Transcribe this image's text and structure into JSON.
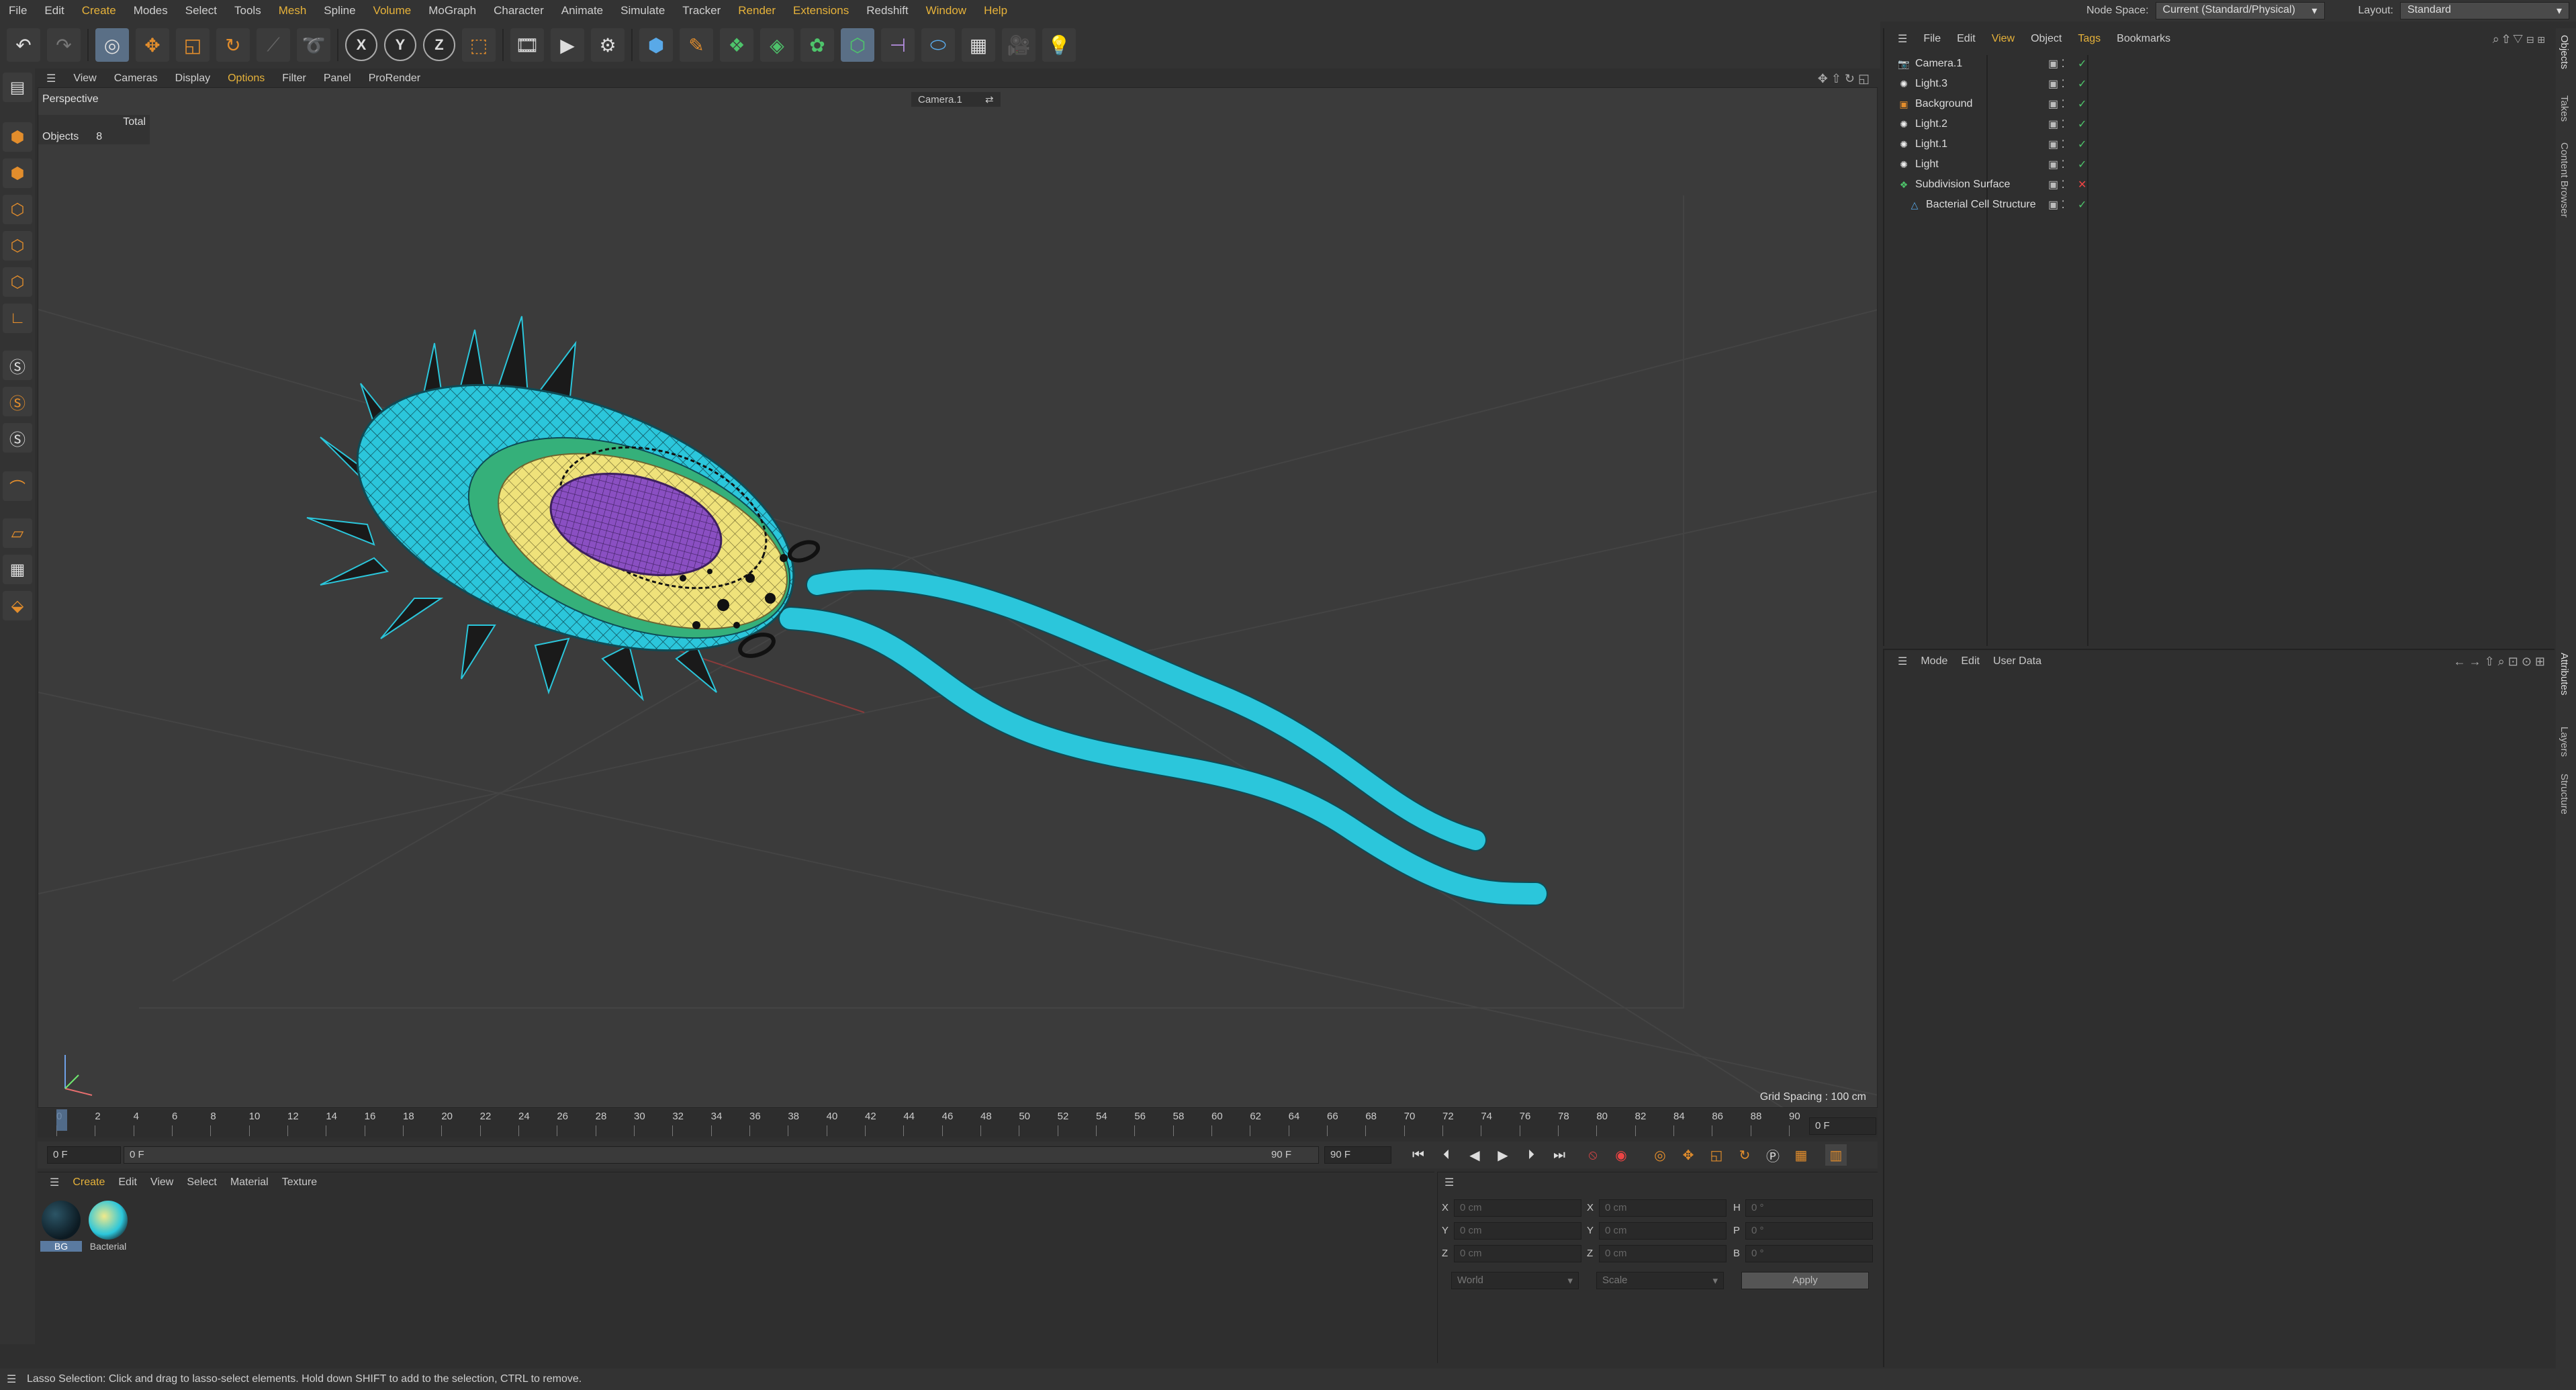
{
  "menubar": {
    "items": [
      "File",
      "Edit",
      "Create",
      "Modes",
      "Select",
      "Tools",
      "Mesh",
      "Spline",
      "Volume",
      "MoGraph",
      "Character",
      "Animate",
      "Simulate",
      "Tracker",
      "Render",
      "Extensions",
      "Redshift",
      "Window",
      "Help"
    ],
    "node_space_label": "Node Space:",
    "node_space_value": "Current (Standard/Physical)",
    "layout_label": "Layout:",
    "layout_value": "Standard"
  },
  "toolbar": {
    "icons": [
      "undo-icon",
      "redo-icon",
      "live-selection-icon",
      "move-icon",
      "scale-icon",
      "rotate-icon",
      "recent-tools-icon",
      "lasso-icon",
      "x-axis-lock",
      "y-axis-lock",
      "z-axis-lock",
      "world-coordinates-icon",
      "render-region-icon",
      "render-view-icon",
      "render-settings-icon",
      "cube-icon",
      "pen-icon",
      "subdivision-icon",
      "extrude-icon",
      "cloner-icon",
      "field-icon",
      "deformer-icon",
      "environment-icon",
      "camera-icon",
      "light-icon"
    ],
    "x_label": "X",
    "y_label": "Y",
    "z_label": "Z"
  },
  "viewport": {
    "menu": [
      "View",
      "Cameras",
      "Display",
      "Options",
      "Filter",
      "Panel",
      "ProRender"
    ],
    "view_name": "Perspective",
    "camera_name": "Camera.1",
    "hud_total": "Total",
    "hud_objects_label": "Objects",
    "hud_objects_value": "8",
    "grid_spacing": "Grid Spacing : 100 cm"
  },
  "timeline": {
    "ticks": [
      "0",
      "2",
      "4",
      "6",
      "8",
      "10",
      "12",
      "14",
      "16",
      "18",
      "20",
      "22",
      "24",
      "26",
      "28",
      "30",
      "32",
      "34",
      "36",
      "38",
      "40",
      "42",
      "44",
      "46",
      "48",
      "50",
      "52",
      "54",
      "56",
      "58",
      "60",
      "62",
      "64",
      "66",
      "68",
      "70",
      "72",
      "74",
      "76",
      "78",
      "80",
      "82",
      "84",
      "86",
      "88",
      "90"
    ],
    "current_frame": "0 F",
    "start_field": "0 F",
    "range_start": "0 F",
    "range_end": "90 F",
    "end_field": "90 F"
  },
  "materials": {
    "menu": [
      "Create",
      "Edit",
      "View",
      "Select",
      "Material",
      "Texture"
    ],
    "items": [
      {
        "name": "BG"
      },
      {
        "name": "Bacterial"
      }
    ]
  },
  "coordinates": {
    "rows": [
      {
        "axis": "X",
        "pos": "0 cm",
        "axis2": "X",
        "size": "0 cm",
        "axis3": "H",
        "rot": "0 °"
      },
      {
        "axis": "Y",
        "pos": "0 cm",
        "axis2": "Y",
        "size": "0 cm",
        "axis3": "P",
        "rot": "0 °"
      },
      {
        "axis": "Z",
        "pos": "0 cm",
        "axis2": "Z",
        "size": "0 cm",
        "axis3": "B",
        "rot": "0 °"
      }
    ],
    "mode_world": "World",
    "mode_scale": "Scale",
    "apply": "Apply"
  },
  "objects": {
    "menu": [
      "File",
      "Edit",
      "View",
      "Object",
      "Tags",
      "Bookmarks"
    ],
    "rows": [
      {
        "name": "Camera.1",
        "icon": "camera-icon"
      },
      {
        "name": "Light.3",
        "icon": "light-icon"
      },
      {
        "name": "Background",
        "icon": "background-icon"
      },
      {
        "name": "Light.2",
        "icon": "light-icon"
      },
      {
        "name": "Light.1",
        "icon": "light-icon"
      },
      {
        "name": "Light",
        "icon": "light-icon"
      },
      {
        "name": "Subdivision Surface",
        "icon": "subdivision-icon"
      },
      {
        "name": "Bacterial Cell Structure",
        "icon": "polygon-object-icon"
      }
    ]
  },
  "attributes": {
    "menu": [
      "Mode",
      "Edit",
      "User Data"
    ]
  },
  "side_tabs": [
    "Objects",
    "Takes",
    "Content Browser",
    "Attributes",
    "Layers",
    "Structure"
  ],
  "status": "Lasso Selection: Click and drag to lasso-select elements. Hold down SHIFT to add to the selection, CTRL to remove.",
  "colors": {
    "accent": "#e6b23a",
    "mesh": "#2bc6db",
    "nucleus": "#8a4fc2",
    "cytoplasm": "#efe27a"
  }
}
